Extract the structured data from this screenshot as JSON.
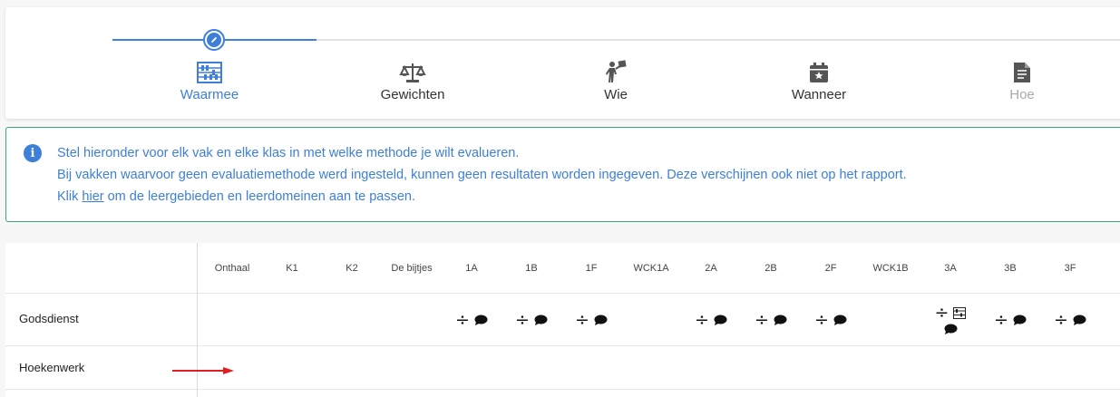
{
  "stepper": {
    "steps": [
      {
        "label": "Waarmee",
        "icon": "abacus-icon",
        "state": "active"
      },
      {
        "label": "Gewichten",
        "icon": "scale-icon",
        "state": "default"
      },
      {
        "label": "Wie",
        "icon": "person-sign-icon",
        "state": "default"
      },
      {
        "label": "Wanneer",
        "icon": "calendar-star-icon",
        "state": "default"
      },
      {
        "label": "Hoe",
        "icon": "document-icon",
        "state": "disabled"
      }
    ],
    "accent": "#3d7fd9"
  },
  "info": {
    "line1": "Stel hieronder voor elk vak en elke klas in met welke methode je wilt evalueren.",
    "line2": "Bij vakken waarvoor geen evaluatiemethode werd ingesteld, kunnen geen resultaten worden ingegeven. Deze verschijnen ook niet op het rapport.",
    "line3_before": "Klik ",
    "line3_link": "hier",
    "line3_after": " om de leergebieden en leerdomeinen aan te passen.",
    "border_color": "#3aa57a"
  },
  "table": {
    "columns": [
      "Onthaal",
      "K1",
      "K2",
      "De bijtjes",
      "1A",
      "1B",
      "1F",
      "WCK1A",
      "2A",
      "2B",
      "2F",
      "WCK1B",
      "3A",
      "3B",
      "3F"
    ],
    "rows": [
      {
        "label": "Godsdienst",
        "cells": {
          "1A": "÷",
          "1B": "÷",
          "1F": "÷",
          "2A": "÷",
          "2B": "÷",
          "2F": "÷",
          "3A": "÷",
          "3B": "÷",
          "3F": "÷"
        }
      },
      {
        "label": "Hoekenwerk",
        "cells": {}
      }
    ]
  }
}
